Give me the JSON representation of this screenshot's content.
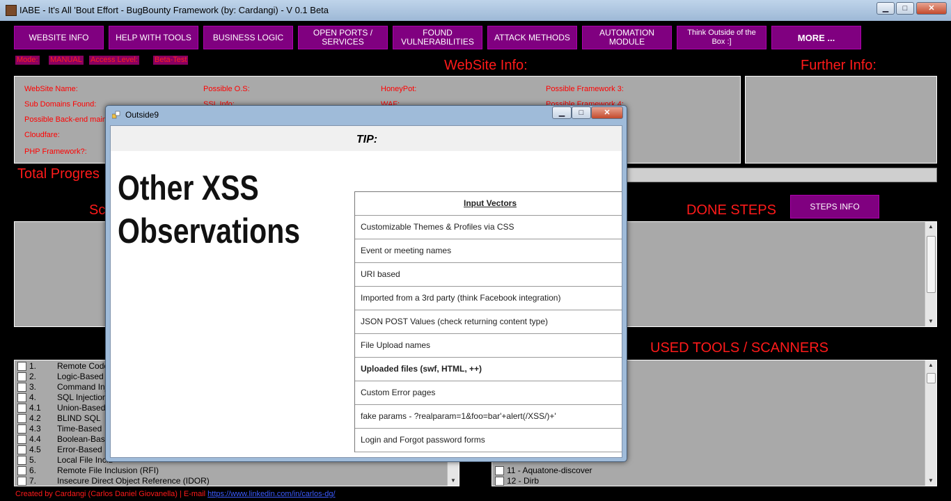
{
  "window": {
    "title": "IABE - It's All 'Bout Effort - BugBounty Framework (by: Cardangi) - V 0.1 Beta",
    "minimize": "▁",
    "maximize": "□",
    "close": "✕"
  },
  "nav": [
    "WEBSITE INFO",
    "HELP WITH TOOLS",
    "BUSINESS LOGIC",
    "OPEN PORTS / SERVICES",
    "FOUND VULNERABILITIES",
    "ATTACK METHODS",
    "AUTOMATION MODULE",
    "Think Outside of the Box :]",
    "MORE ..."
  ],
  "status": {
    "mode_label": "Mode:",
    "mode_value": "MANUAL",
    "access_label": "Access Level:",
    "access_value": "Beta-Test"
  },
  "headings": {
    "website_info": "WebSite Info:",
    "further_info": "Further Info:",
    "total_progress": "Total Progres",
    "scope_partial": "Sc",
    "done_steps": "DONE STEPS",
    "used_tools": "USED TOOLS / SCANNERS"
  },
  "website_fields": {
    "col1": [
      "WebSite Name:",
      "Sub Domains Found:",
      "Possible Back-end main-",
      "Cloudfare:",
      "PHP Framework?:"
    ],
    "col2": [
      "Possible O.S:",
      "SSL Info:",
      "",
      "",
      ""
    ],
    "col3": [
      "HoneyPot:",
      "WAF:",
      "",
      "",
      ""
    ],
    "col4": [
      "Possible Framework 3:",
      "Possible Framework 4:",
      "",
      "",
      ""
    ]
  },
  "steps_info_button": "STEPS INFO",
  "vuln_list": [
    {
      "num": "1.",
      "label": "Remote Code"
    },
    {
      "num": "2.",
      "label": "Logic-Based F"
    },
    {
      "num": "3.",
      "label": "Command Inje"
    },
    {
      "num": "4.",
      "label": "SQL Injection"
    },
    {
      "num": "4.1",
      "label": "Union-Based"
    },
    {
      "num": "4.2",
      "label": "BLIND SQL"
    },
    {
      "num": "4.3",
      "label": "Time-Based"
    },
    {
      "num": "4.4",
      "label": "Boolean-Based"
    },
    {
      "num": "4.5",
      "label": "Error-Based"
    },
    {
      "num": "5.",
      "label": "Local File Inclu"
    },
    {
      "num": "6.",
      "label": "Remote File Inclusion (RFI)"
    },
    {
      "num": "7.",
      "label": "Insecure Direct Object Reference (IDOR)"
    }
  ],
  "tools_list": [
    {
      "label": "11 - Aquatone-discover"
    },
    {
      "label": "12 - Dirb"
    }
  ],
  "footer": {
    "text": "Created by Cardangi (Carlos Daniel Giovanella) | E-mail ",
    "link": "https://www.linkedin.com/in/carlos-dg/"
  },
  "popup": {
    "title": "Outside9",
    "tip_label": "TIP:",
    "heading_line1": "Other XSS",
    "heading_line2": "Observations",
    "vectors_header": "Input Vectors",
    "vectors": [
      "Customizable Themes & Profiles via CSS",
      "Event or meeting names",
      "URI based",
      "Imported from a 3rd party (think Facebook integration)",
      "JSON POST Values (check returning content type)",
      "File Upload names",
      "Uploaded files (swf, HTML, ++)",
      "Custom Error pages",
      "fake params - ?realparam=1&foo=bar'+alert(/XSS/)+'",
      "Login and Forgot password forms"
    ]
  },
  "colors": {
    "background": "#000000",
    "accent_purple": "#800080",
    "label_red": "#ff1a1a",
    "panel_gray": "#a9a9a9"
  }
}
